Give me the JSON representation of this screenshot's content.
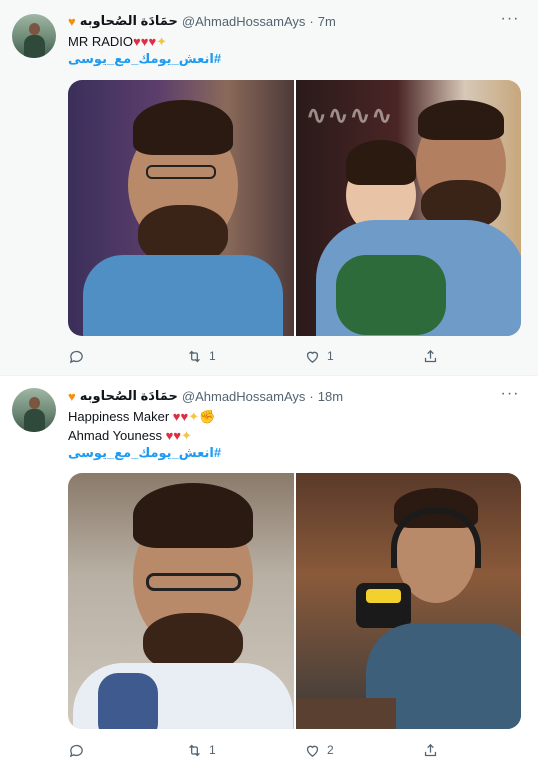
{
  "tweets": [
    {
      "display_name": "حمَادَة الصُحاوبه",
      "handle": "@AhmadHossamAys",
      "separator": "·",
      "time": "7m",
      "text_line1": "MR RADIO",
      "hashtag": "#انعش_يومك_مع_يوسى",
      "actions": {
        "replies": "",
        "retweets": "1",
        "likes": "1"
      }
    },
    {
      "display_name": "حمَادَة الصُحاوبه",
      "handle": "@AhmadHossamAys",
      "separator": "·",
      "time": "18m",
      "text_line1": "Happiness Maker",
      "text_line2": "Ahmad Youness",
      "hashtag": "#انعش_يومك_مع_يوسى",
      "actions": {
        "replies": "",
        "retweets": "1",
        "likes": "2"
      }
    }
  ],
  "colors": {
    "accent": "#1d9bf0",
    "muted": "#536471",
    "heart": "#dd2e44",
    "orange_heart": "#f4900c"
  },
  "icons": [
    "orange-heart-emoji",
    "red-heart-emoji",
    "sparkles-emoji",
    "muscle-emoji",
    "more-icon",
    "reply-icon",
    "retweet-icon",
    "like-icon",
    "share-icon"
  ]
}
